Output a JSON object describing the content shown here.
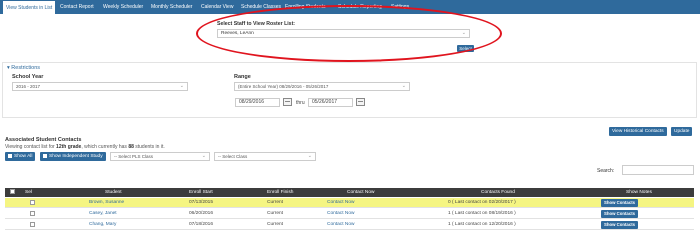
{
  "nav": {
    "tabs": [
      {
        "label": "View Students in List",
        "active": true
      },
      {
        "label": "Contact Report"
      },
      {
        "label": "Weekly Scheduler"
      },
      {
        "label": "Monthly Scheduler"
      },
      {
        "label": "Calendar View"
      },
      {
        "label": "Schedule Classes"
      },
      {
        "label": "Enrolling Students"
      },
      {
        "label": "Schedule Reporting"
      },
      {
        "label": "Settings"
      }
    ]
  },
  "staff": {
    "label": "Select Staff to View Roster List:",
    "selected": "Reeves, LeAnn",
    "select_button": "Select"
  },
  "restrictions": {
    "title": "Restrictions",
    "school_year_label": "School Year",
    "school_year_value": "2016 - 2017",
    "range_label": "Range",
    "range_value": "(Entire School Year) 08/29/2016 - 05/26/2017",
    "start_date": "08/29/2016",
    "thru_label": "thru",
    "end_date": "05/26/2017"
  },
  "associated": {
    "title": "Associated Student Contacts",
    "viewing_prefix": "Viewing contact list for ",
    "viewing_grade": "12th grade",
    "viewing_middle": ", which currently has ",
    "viewing_count": "88",
    "viewing_suffix": " students in it.",
    "view_historical_button": "View Historical Contacts",
    "update_button": "Update",
    "show_all_button": "Show All",
    "show_independent_button": "Show Independent Study",
    "pls_class_select": "-- Select PLS Class",
    "class_select": "-- Select Class",
    "search_label": "Search:"
  },
  "table": {
    "headers": [
      "Sel",
      "Student",
      "Enroll Start",
      "Enroll Finish",
      "Contact Now",
      "Contacts Found",
      "Show Notes"
    ],
    "rows": [
      {
        "student": "Brown, Susanne",
        "start": "07/13/2015",
        "finish": "Current",
        "contact": "Contact Now",
        "found": "0 ( Last contact on 02/20/2017 )",
        "notes": "Show Contacts",
        "highlight": true
      },
      {
        "student": "Casey, Janet",
        "start": "06/20/2016",
        "finish": "Current",
        "contact": "Contact Now",
        "found": "1 ( Last contact on 08/19/2016 )",
        "notes": "Show Contacts",
        "highlight": false
      },
      {
        "student": "Chang, Mary",
        "start": "07/18/2016",
        "finish": "Current",
        "contact": "Contact Now",
        "found": "1 ( Last contact on 12/20/2016 )",
        "notes": "Show Contacts",
        "highlight": false
      }
    ]
  }
}
